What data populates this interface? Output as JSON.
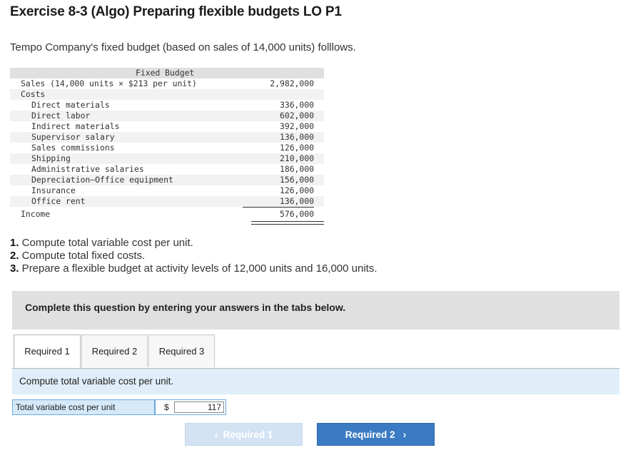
{
  "header": {
    "title": "Exercise 8-3 (Algo) Preparing flexible budgets LO P1"
  },
  "intro": "Tempo Company's fixed budget (based on sales of 14,000 units) folllows.",
  "budget": {
    "column_header": "Fixed Budget",
    "sales_label": "Sales (14,000 units × $213 per unit)",
    "sales_value": "2,982,000",
    "costs_label": "Costs",
    "costs": [
      {
        "label": "Direct materials",
        "value": "336,000"
      },
      {
        "label": "Direct labor",
        "value": "602,000"
      },
      {
        "label": "Indirect materials",
        "value": "392,000"
      },
      {
        "label": "Supervisor salary",
        "value": "136,000"
      },
      {
        "label": "Sales commissions",
        "value": "126,000"
      },
      {
        "label": "Shipping",
        "value": "210,000"
      },
      {
        "label": "Administrative salaries",
        "value": "186,000"
      },
      {
        "label": "Depreciation—Office equipment",
        "value": "156,000"
      },
      {
        "label": "Insurance",
        "value": "126,000"
      },
      {
        "label": "Office rent",
        "value": "136,000"
      }
    ],
    "income_label": "Income",
    "income_value": "576,000"
  },
  "questions": [
    {
      "num": "1.",
      "text": " Compute total variable cost per unit."
    },
    {
      "num": "2.",
      "text": " Compute total fixed costs."
    },
    {
      "num": "3.",
      "text": " Prepare a flexible budget at activity levels of 12,000 units and 16,000 units."
    }
  ],
  "banner": "Complete this question by entering your answers in the tabs below.",
  "tabs": [
    {
      "label": "Required 1",
      "active": true
    },
    {
      "label": "Required 2",
      "active": false
    },
    {
      "label": "Required 3",
      "active": false
    }
  ],
  "instruction": "Compute total variable cost per unit.",
  "answer": {
    "label": "Total variable cost per unit",
    "currency": "$",
    "value": "117"
  },
  "nav": {
    "prev_label": "Required 1",
    "next_label": "Required 2",
    "prev_icon": "chevron-left-icon",
    "next_icon": "chevron-right-icon"
  },
  "colors": {
    "accent": "#3b7bc4",
    "accent_disabled": "#d4e3f3",
    "input_fill": "#d6e9f8",
    "banner_bg": "#e0e0e0"
  }
}
